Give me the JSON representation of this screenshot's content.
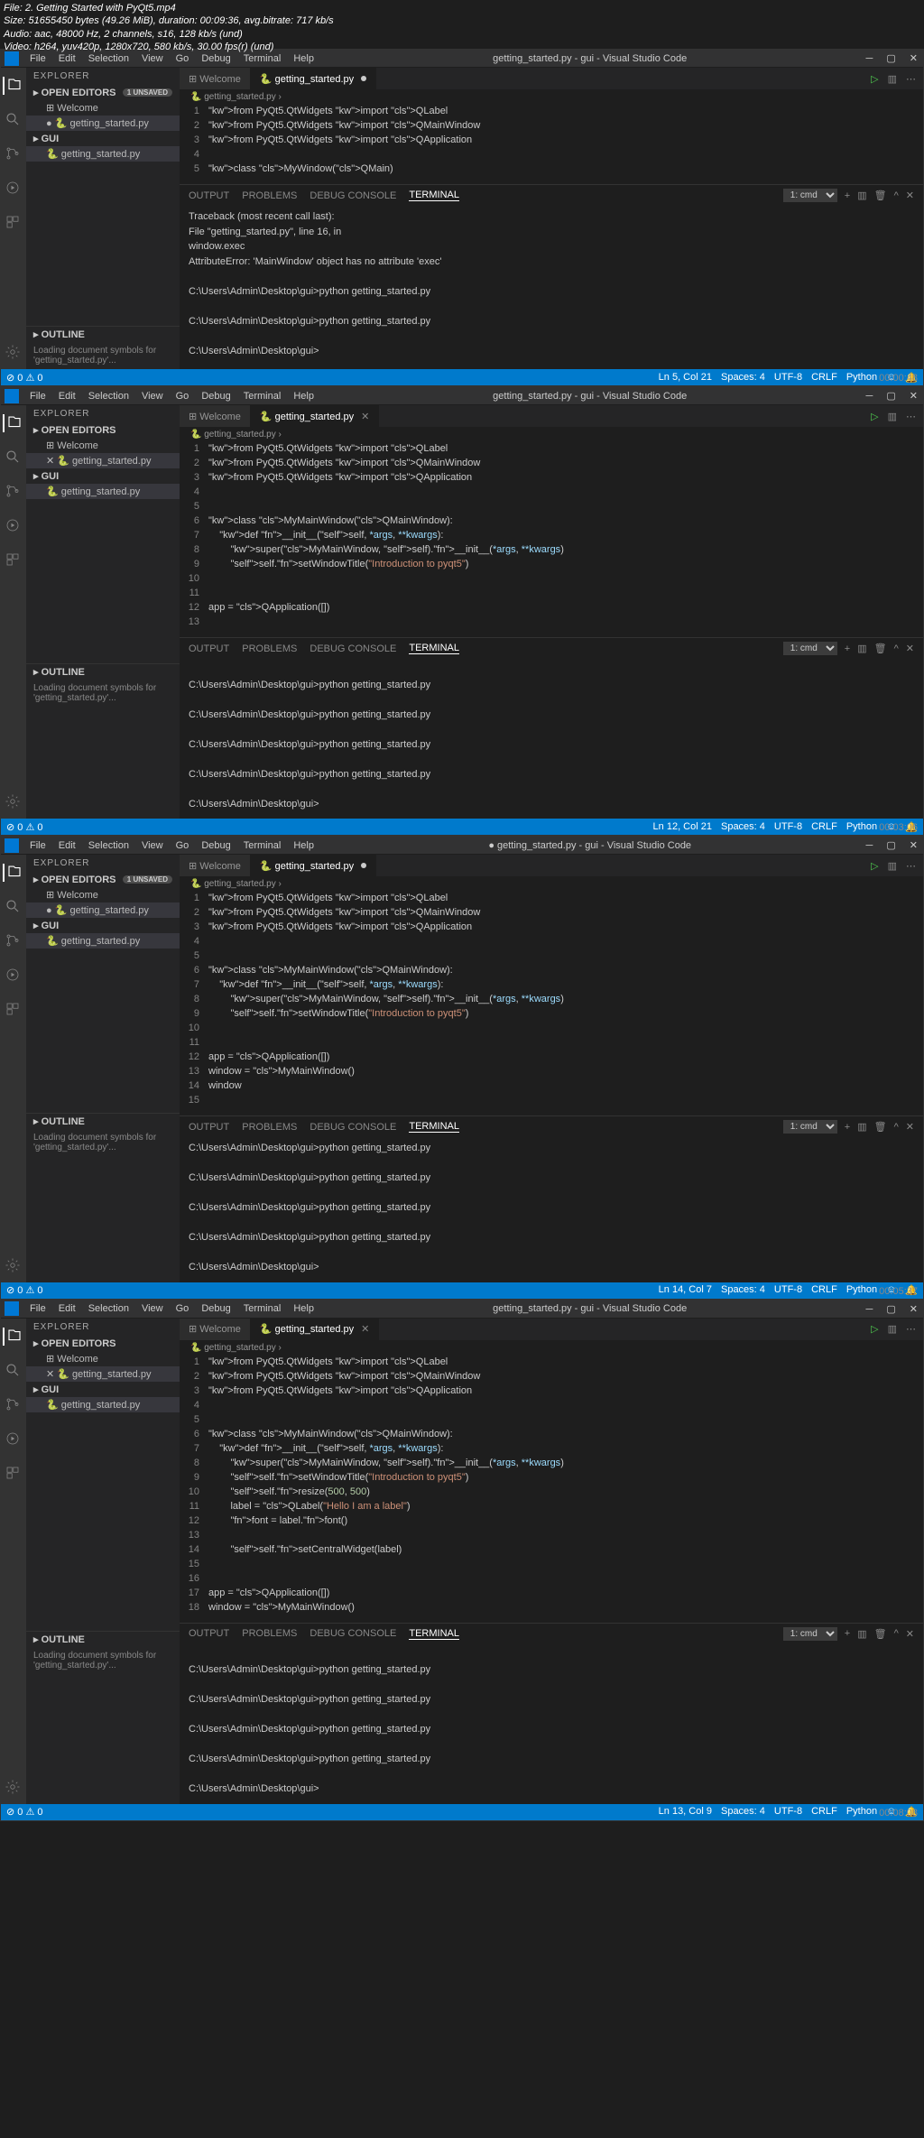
{
  "overlay": {
    "file": "File: 2. Getting Started with PyQt5.mp4",
    "size": "Size: 51655450 bytes (49.26 MiB), duration: 00:09:36, avg.bitrate: 717 kb/s",
    "audio": "Audio: aac, 48000 Hz, 2 channels, s16, 128 kb/s (und)",
    "video": "Video: h264, yuv420p, 1280x720, 580 kb/s, 30.00 fps(r) (und)"
  },
  "common": {
    "menubar": [
      "File",
      "Edit",
      "Selection",
      "View",
      "Go",
      "Debug",
      "Terminal",
      "Help"
    ],
    "explorer_hdr": "EXPLORER",
    "open_editors": "OPEN EDITORS",
    "gui_section": "GUI",
    "outline": "OUTLINE",
    "welcome_tab": "Welcome",
    "file_tab": "getting_started.py",
    "breadcrumb": "getting_started.py",
    "panel_tabs": [
      "OUTPUT",
      "PROBLEMS",
      "DEBUG CONSOLE",
      "TERMINAL"
    ],
    "terminal_select": "1: cmd",
    "status_left": "⊘ 0 ⚠ 0",
    "status_items": [
      "Spaces: 4",
      "UTF-8",
      "CRLF",
      "Python"
    ],
    "unsaved_badge": "1 UNSAVED",
    "loading": "Loading document symbols for 'getting_started.py'..."
  },
  "frames": [
    {
      "title": "getting_started.py - gui - Visual Studio Code",
      "modified": true,
      "code": [
        "from PyQt5.QtWidgets import QLabel",
        "from PyQt5.QtWidgets import QMainWindow",
        "from PyQt5.QtWidgets import QApplication",
        "",
        "class MyWindow(QMain)"
      ],
      "terminal": [
        "Traceback (most recent call last):",
        "  File \"getting_started.py\", line 16, in <module>",
        "    window.exec",
        "AttributeError: 'MainWindow' object has no attribute 'exec'",
        "",
        "C:\\Users\\Admin\\Desktop\\gui>python getting_started.py",
        "",
        "C:\\Users\\Admin\\Desktop\\gui>python getting_started.py",
        "",
        "C:\\Users\\Admin\\Desktop\\gui>"
      ],
      "status_pos": "Ln 5, Col 21",
      "ts": "00:00:48"
    },
    {
      "title": "getting_started.py - gui - Visual Studio Code",
      "modified": false,
      "code": [
        "from PyQt5.QtWidgets import QLabel",
        "from PyQt5.QtWidgets import QMainWindow",
        "from PyQt5.QtWidgets import QApplication",
        "",
        "",
        "class MyMainWindow(QMainWindow):",
        "    def __init__(self, *args, **kwargs):",
        "        super(MyMainWindow, self).__init__(*args, **kwargs)",
        "        self.setWindowTitle(\"Introduction to pyqt5\")",
        "",
        "",
        "app = QApplication([])",
        ""
      ],
      "terminal": [
        "",
        "C:\\Users\\Admin\\Desktop\\gui>python getting_started.py",
        "",
        "C:\\Users\\Admin\\Desktop\\gui>python getting_started.py",
        "",
        "C:\\Users\\Admin\\Desktop\\gui>python getting_started.py",
        "",
        "C:\\Users\\Admin\\Desktop\\gui>python getting_started.py",
        "",
        "C:\\Users\\Admin\\Desktop\\gui>"
      ],
      "status_pos": "Ln 12, Col 21",
      "ts": "00:03:06"
    },
    {
      "title": "● getting_started.py - gui - Visual Studio Code",
      "modified": true,
      "code": [
        "from PyQt5.QtWidgets import QLabel",
        "from PyQt5.QtWidgets import QMainWindow",
        "from PyQt5.QtWidgets import QApplication",
        "",
        "",
        "class MyMainWindow(QMainWindow):",
        "    def __init__(self, *args, **kwargs):",
        "        super(MyMainWindow, self).__init__(*args, **kwargs)",
        "        self.setWindowTitle(\"Introduction to pyqt5\")",
        "",
        "",
        "app = QApplication([])",
        "window = MyMainWindow()",
        "window",
        ""
      ],
      "terminal": [
        "C:\\Users\\Admin\\Desktop\\gui>python getting_started.py",
        "",
        "C:\\Users\\Admin\\Desktop\\gui>python getting_started.py",
        "",
        "C:\\Users\\Admin\\Desktop\\gui>python getting_started.py",
        "",
        "C:\\Users\\Admin\\Desktop\\gui>python getting_started.py",
        "",
        "C:\\Users\\Admin\\Desktop\\gui>"
      ],
      "status_pos": "Ln 14, Col 7",
      "ts": "00:05:37"
    },
    {
      "title": "getting_started.py - gui - Visual Studio Code",
      "modified": false,
      "code": [
        "from PyQt5.QtWidgets import QLabel",
        "from PyQt5.QtWidgets import QMainWindow",
        "from PyQt5.QtWidgets import QApplication",
        "",
        "",
        "class MyMainWindow(QMainWindow):",
        "    def __init__(self, *args, **kwargs):",
        "        super(MyMainWindow, self).__init__(*args, **kwargs)",
        "        self.setWindowTitle(\"Introduction to pyqt5\")",
        "        self.resize(500, 500)",
        "        label = QLabel(\"Hello I am a label\")",
        "        font = label.font()",
        "        ",
        "        self.setCentralWidget(label)",
        "",
        "",
        "app = QApplication([])",
        "window = MyMainWindow()"
      ],
      "terminal": [
        "",
        "C:\\Users\\Admin\\Desktop\\gui>python getting_started.py",
        "",
        "C:\\Users\\Admin\\Desktop\\gui>python getting_started.py",
        "",
        "C:\\Users\\Admin\\Desktop\\gui>python getting_started.py",
        "",
        "C:\\Users\\Admin\\Desktop\\gui>python getting_started.py",
        "",
        "C:\\Users\\Admin\\Desktop\\gui>"
      ],
      "status_pos": "Ln 13, Col 9",
      "ts": "00:08:08"
    }
  ]
}
